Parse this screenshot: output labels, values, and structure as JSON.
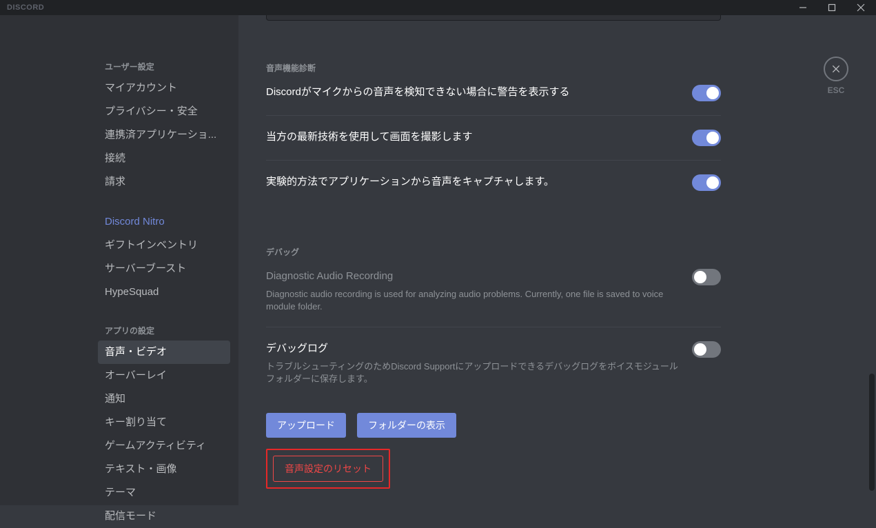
{
  "titlebar": {
    "brand": "DISCORD"
  },
  "close": {
    "esc": "ESC"
  },
  "sidebar": {
    "header1": "ユーザー設定",
    "items1": [
      "マイアカウント",
      "プライバシー・安全",
      "連携済アプリケーショ...",
      "接続",
      "請求"
    ],
    "nitro": "Discord Nitro",
    "items2": [
      "ギフトインベントリ",
      "サーバーブースト",
      "HypeSquad"
    ],
    "header2": "アプリの設定",
    "items3": [
      "音声・ビデオ",
      "オーバーレイ",
      "通知",
      "キー割り当て",
      "ゲームアクティビティ",
      "テキスト・画像",
      "テーマ",
      "配信モード"
    ],
    "activeIndex3": 0
  },
  "sections": {
    "diag_header": "音声機能診断",
    "diag1": {
      "title": "Discordがマイクからの音声を検知できない場合に警告を表示する",
      "on": true
    },
    "diag2": {
      "title": "当方の最新技術を使用して画面を撮影します",
      "on": true
    },
    "diag3": {
      "title": "実験的方法でアプリケーションから音声をキャプチャします。",
      "on": true
    },
    "debug_header": "デバッグ",
    "debug1": {
      "title": "Diagnostic Audio Recording",
      "desc": "Diagnostic audio recording is used for analyzing audio problems. Currently, one file is saved to voice module folder.",
      "on": false
    },
    "debug2": {
      "title": "デバッグログ",
      "desc": "トラブルシューティングのためDiscord Supportにアップロードできるデバッグログをボイスモジュールフォルダーに保存します。",
      "on": false
    },
    "buttons": {
      "upload": "アップロード",
      "show_folder": "フォルダーの表示",
      "reset": "音声設定のリセット"
    }
  }
}
